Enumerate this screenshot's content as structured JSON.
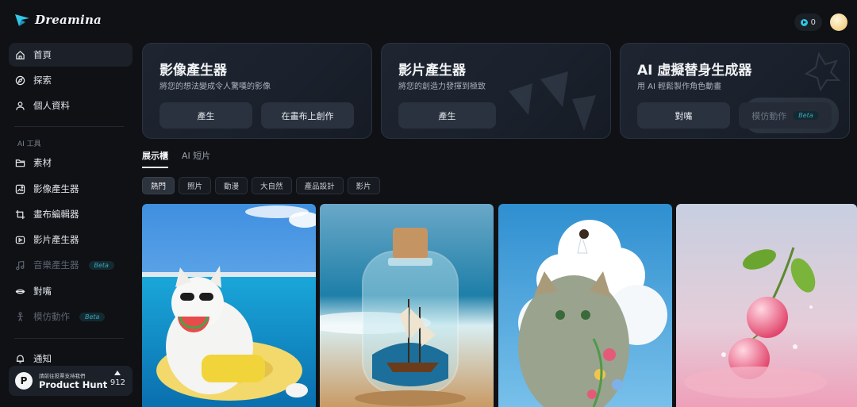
{
  "app": {
    "name": "Dreamina"
  },
  "header": {
    "credits": "0"
  },
  "sidebar": {
    "items": [
      {
        "label": "首頁",
        "icon": "home-icon",
        "active": true
      },
      {
        "label": "探索",
        "icon": "compass-icon"
      },
      {
        "label": "個人資料",
        "icon": "user-icon"
      }
    ],
    "section_label": "AI 工具",
    "tools": [
      {
        "label": "素材",
        "icon": "folder-icon"
      },
      {
        "label": "影像產生器",
        "icon": "image-generator-icon"
      },
      {
        "label": "畫布編輯器",
        "icon": "canvas-crop-icon"
      },
      {
        "label": "影片產生器",
        "icon": "video-generator-icon"
      },
      {
        "label": "音樂產生器",
        "icon": "music-note-icon",
        "badge": "Beta",
        "disabled": true
      },
      {
        "label": "對嘴",
        "icon": "lip-sync-icon"
      },
      {
        "label": "模仿動作",
        "icon": "motion-figure-icon",
        "badge": "Beta",
        "disabled": true
      }
    ],
    "notification": {
      "label": "通知",
      "icon": "bell-icon"
    },
    "product_hunt": {
      "caption": "請前往投票支持我們",
      "name": "Product Hunt",
      "votes": "912"
    }
  },
  "features": [
    {
      "title": "影像產生器",
      "subtitle": "將您的想法變成令人驚嘆的影像",
      "buttons": [
        "產生",
        "在畫布上創作"
      ]
    },
    {
      "title": "影片產生器",
      "subtitle": "將您的創造力發揮到極致",
      "buttons": [
        "產生"
      ]
    },
    {
      "title": "AI 虛擬替身生成器",
      "subtitle": "用 AI 輕鬆製作角色動畫",
      "buttons": [
        "對嘴",
        "模仿動作"
      ],
      "disabled_badge": "Beta"
    }
  ],
  "tabs": [
    "展示櫃",
    "AI 短片"
  ],
  "filters": [
    "熱門",
    "照片",
    "動漫",
    "大自然",
    "產品設計",
    "影片"
  ],
  "colors": {
    "background": "#0f1115",
    "accent": "#2fc4e4",
    "card": "#1c2230"
  }
}
